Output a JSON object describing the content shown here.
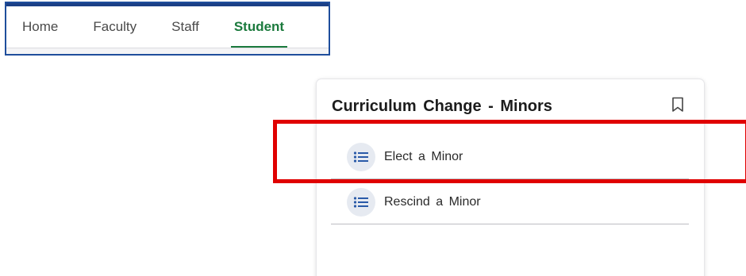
{
  "nav": {
    "tabs": [
      {
        "label": "Home",
        "active": false
      },
      {
        "label": "Faculty",
        "active": false
      },
      {
        "label": "Staff",
        "active": false
      },
      {
        "label": "Student",
        "active": true
      }
    ],
    "active_color": "#1b7a3d",
    "frame_color": "#1f4e9c"
  },
  "card": {
    "title": "Curriculum Change - Minors",
    "bookmark_icon": "bookmark-icon",
    "items": [
      {
        "label": "Elect a Minor",
        "icon": "list-icon"
      },
      {
        "label": "Rescind a Minor",
        "icon": "list-icon"
      }
    ]
  },
  "highlight": {
    "color": "#e00000",
    "target": "Elect a Minor"
  }
}
